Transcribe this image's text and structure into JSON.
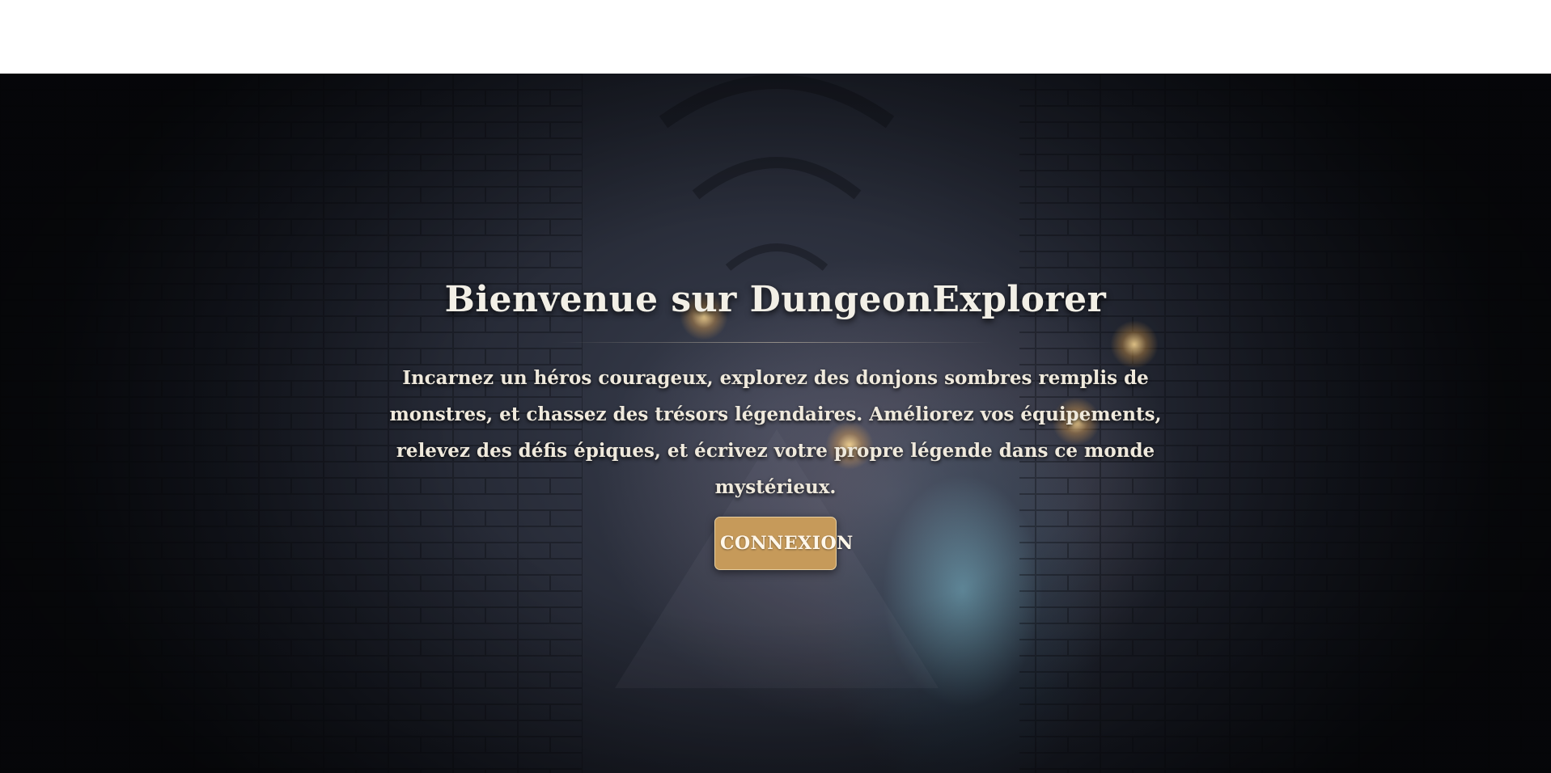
{
  "hero": {
    "title": "Bienvenue sur DungeonExplorer",
    "description": "Incarnez un héros courageux, explorez des donjons sombres remplis de monstres, et chassez des trésors légendaires. Améliorez vos équipements, relevez des défis épiques, et écrivez votre propre légende dans ce monde mystérieux.",
    "login_label": "CONNEXION"
  },
  "colors": {
    "button_background": "#c69a5a",
    "button_border": "#e8cf9f",
    "title_text": "#f2efe6",
    "topbar_background": "#ffffff"
  }
}
